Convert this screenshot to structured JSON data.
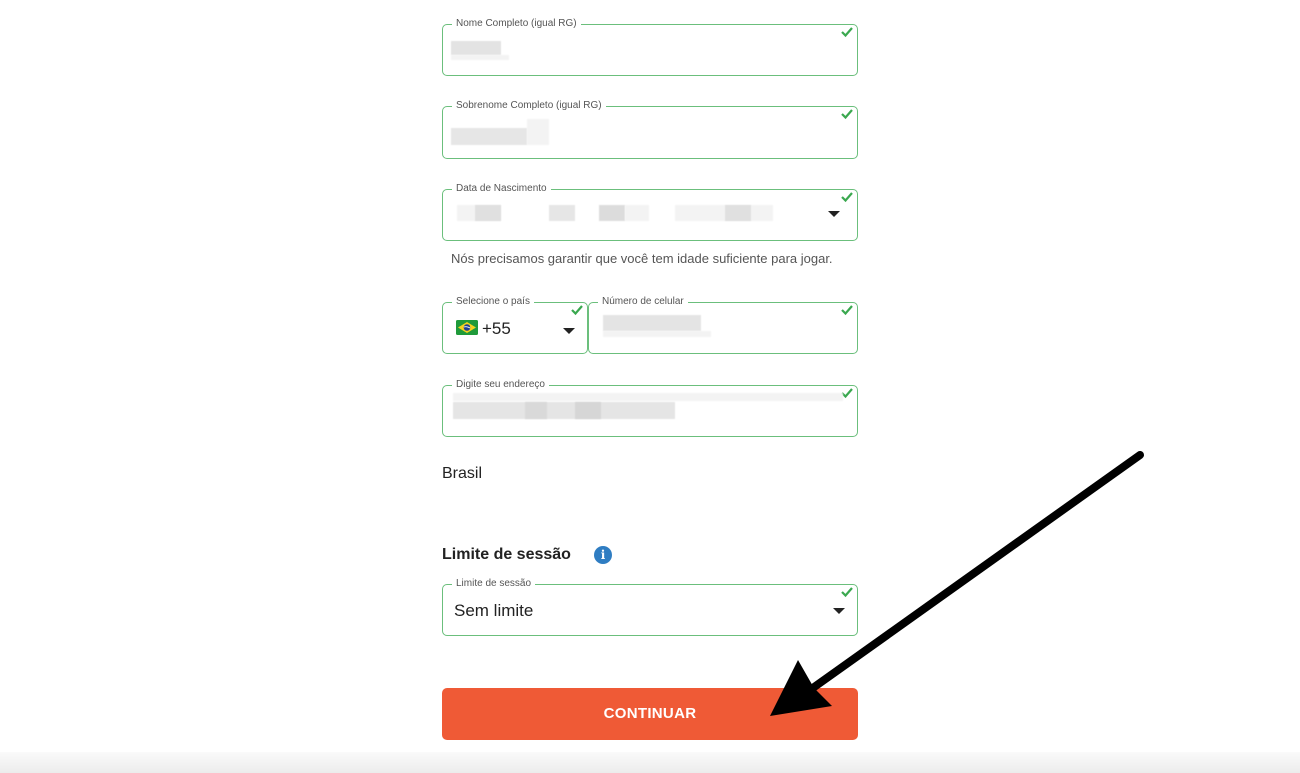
{
  "form": {
    "first_name": {
      "label": "Nome Completo (igual RG)",
      "value": ""
    },
    "last_name": {
      "label": "Sobrenome Completo (igual RG)",
      "value": ""
    },
    "birth_date": {
      "label": "Data de Nascimento",
      "value": ""
    },
    "age_notice": "Nós precisamos garantir que você tem idade suficiente para jogar.",
    "country_code": {
      "label": "Selecione o país",
      "value": "+55",
      "flag": "brazil-flag-icon"
    },
    "phone": {
      "label": "Número de celular",
      "value": ""
    },
    "address": {
      "label": "Digite seu endereço",
      "value": ""
    },
    "country_name": "Brasil",
    "session_section_title": "Limite de sessão",
    "session_limit": {
      "label": "Limite de sessão",
      "value": "Sem limite"
    },
    "submit_label": "CONTINUAR"
  },
  "colors": {
    "field_border": "#6bbf7c",
    "check": "#3aa84f",
    "button": "#ef5a36",
    "info": "#2f7dc2",
    "annotation_arrow": "#000000"
  }
}
